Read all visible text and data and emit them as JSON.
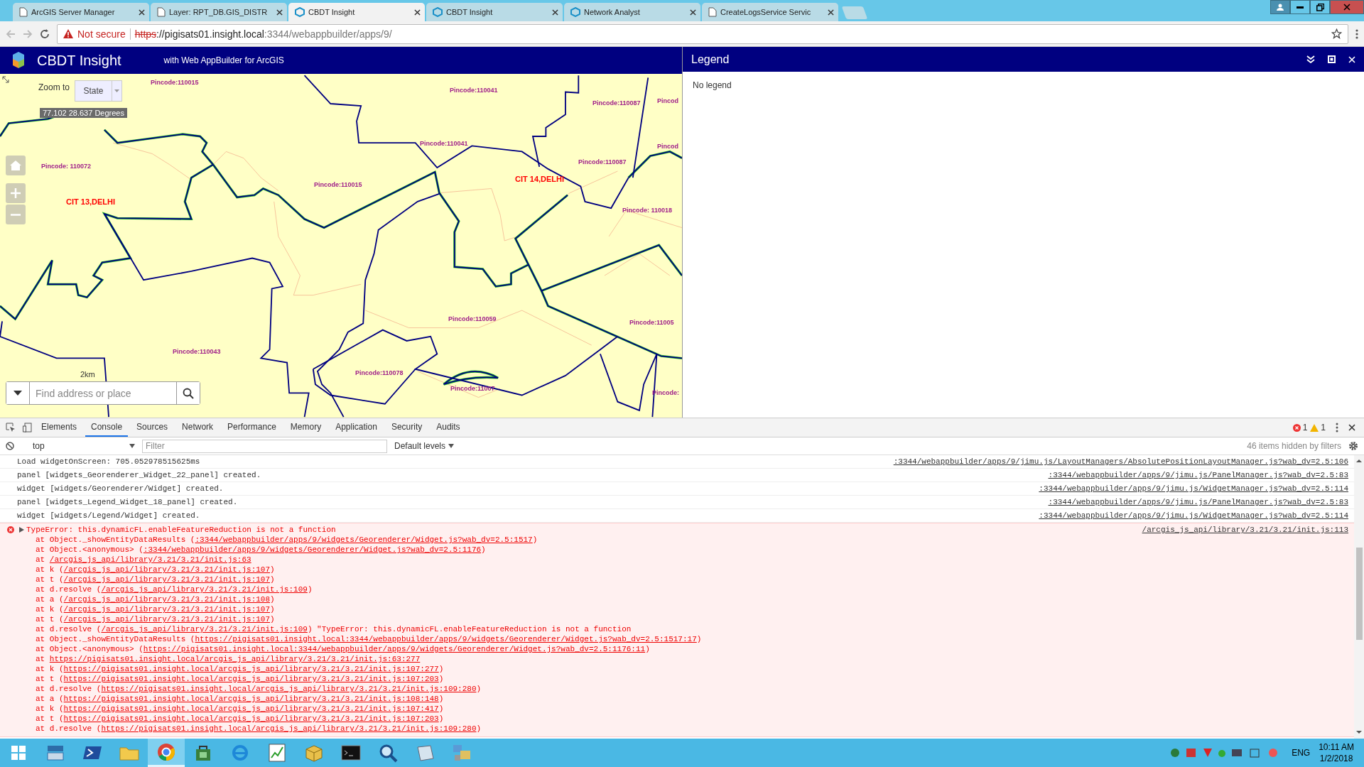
{
  "browser": {
    "tabs": [
      {
        "title": "ArcGIS Server Manager",
        "kind": "page",
        "selected": false
      },
      {
        "title": "Layer: RPT_DB.GIS_DISTR",
        "kind": "page",
        "selected": false
      },
      {
        "title": "CBDT Insight",
        "kind": "app",
        "selected": true
      },
      {
        "title": "CBDT Insight",
        "kind": "app",
        "selected": false
      },
      {
        "title": "Network Analyst",
        "kind": "app",
        "selected": false
      },
      {
        "title": "CreateLogsService Servic",
        "kind": "page",
        "selected": false
      }
    ],
    "security": "Not secure",
    "scheme": "https",
    "host": "://pigisats01.insight.local",
    "path": ":3344/webappbuilder/apps/9/"
  },
  "app": {
    "title": "CBDT Insight",
    "subtitle": "with Web AppBuilder for ArcGIS"
  },
  "map": {
    "zoom_to_label": "Zoom to",
    "zoom_to_value": "State",
    "coordinates": "77.102 28.637 Degrees",
    "scale_label": "2km",
    "search_placeholder": "Find address or place",
    "labels": [
      {
        "text": "Pincode:110015",
        "kind": "pincode"
      },
      {
        "text": "Pincode:110041",
        "kind": "pincode"
      },
      {
        "text": "Pincode:110087",
        "kind": "pincode"
      },
      {
        "text": "Pincod",
        "kind": "pincode"
      },
      {
        "text": "Pincode: 110072",
        "kind": "pincode"
      },
      {
        "text": "Pincode:110041",
        "kind": "pincode"
      },
      {
        "text": "Pincode:110087",
        "kind": "pincode"
      },
      {
        "text": "Pincod",
        "kind": "pincode"
      },
      {
        "text": "Pincode:110015",
        "kind": "pincode"
      },
      {
        "text": "CIT 14,DELHI",
        "kind": "city"
      },
      {
        "text": "CIT 13,DELHI",
        "kind": "city"
      },
      {
        "text": "Pincode: 110018",
        "kind": "pincode"
      },
      {
        "text": "Pincode:110059",
        "kind": "pincode"
      },
      {
        "text": "Pincode:11005",
        "kind": "pincode"
      },
      {
        "text": "Pincode:110043",
        "kind": "pincode"
      },
      {
        "text": "Pincode:110078",
        "kind": "pincode"
      },
      {
        "text": "Pincode:11007",
        "kind": "pincode"
      },
      {
        "text": "Pincode:",
        "kind": "pincode"
      }
    ]
  },
  "legend": {
    "title": "Legend",
    "message": "No legend"
  },
  "devtools": {
    "tabs": [
      {
        "label": "Elements",
        "selected": false
      },
      {
        "label": "Console",
        "selected": true
      },
      {
        "label": "Sources",
        "selected": false
      },
      {
        "label": "Network",
        "selected": false
      },
      {
        "label": "Performance",
        "selected": false
      },
      {
        "label": "Memory",
        "selected": false
      },
      {
        "label": "Application",
        "selected": false
      },
      {
        "label": "Security",
        "selected": false
      },
      {
        "label": "Audits",
        "selected": false
      }
    ],
    "error_count": "1",
    "warning_count": "1",
    "context": "top",
    "filter_placeholder": "Filter",
    "levels": "Default levels",
    "hidden_note": "46 items hidden by filters",
    "logs": [
      {
        "text": "Load widgetOnScreen: 705.052978515625ms",
        "source": ":3344/webappbuilder/apps/9/jimu.js/LayoutManagers/AbsolutePositionLayoutManager.js?wab_dv=2.5:106"
      },
      {
        "text": "panel [widgets_Georenderer_Widget_22_panel] created.",
        "source": ":3344/webappbuilder/apps/9/jimu.js/PanelManager.js?wab_dv=2.5:83"
      },
      {
        "text": "widget [widgets/Georenderer/Widget] created.",
        "source": ":3344/webappbuilder/apps/9/jimu.js/WidgetManager.js?wab_dv=2.5:114"
      },
      {
        "text": "panel [widgets_Legend_Widget_18_panel] created.",
        "source": ":3344/webappbuilder/apps/9/jimu.js/PanelManager.js?wab_dv=2.5:83"
      },
      {
        "text": "widget [widgets/Legend/Widget] created.",
        "source": ":3344/webappbuilder/apps/9/jimu.js/WidgetManager.js?wab_dv=2.5:114"
      }
    ],
    "error": {
      "message": "TypeError: this.dynamicFL.enableFeatureReduction is not a function",
      "source": "/arcgis_js_api/library/3.21/3.21/init.js:113",
      "stack": [
        {
          "prefix": "at Object._showEntityDataResults (",
          "link": ":3344/webappbuilder/apps/9/widgets/Georenderer/Widget.js?wab_dv=2.5:1517",
          "suffix": ")"
        },
        {
          "prefix": "at Object.<anonymous> (",
          "link": ":3344/webappbuilder/apps/9/widgets/Georenderer/Widget.js?wab_dv=2.5:1176",
          "suffix": ")"
        },
        {
          "prefix": "at ",
          "link": "/arcgis_js_api/library/3.21/3.21/init.js:63"
        },
        {
          "prefix": "at k (",
          "link": "/arcgis_js_api/library/3.21/3.21/init.js:107",
          "suffix": ")"
        },
        {
          "prefix": "at t (",
          "link": "/arcgis_js_api/library/3.21/3.21/init.js:107",
          "suffix": ")"
        },
        {
          "prefix": "at d.resolve (",
          "link": "/arcgis_js_api/library/3.21/3.21/init.js:109",
          "suffix": ")"
        },
        {
          "prefix": "at a (",
          "link": "/arcgis_js_api/library/3.21/3.21/init.js:108",
          "suffix": ")"
        },
        {
          "prefix": "at k (",
          "link": "/arcgis_js_api/library/3.21/3.21/init.js:107",
          "suffix": ")"
        },
        {
          "prefix": "at t (",
          "link": "/arcgis_js_api/library/3.21/3.21/init.js:107",
          "suffix": ")"
        },
        {
          "prefix": "at d.resolve (",
          "link": "/arcgis_js_api/library/3.21/3.21/init.js:109",
          "suffix": ") \"TypeError: this.dynamicFL.enableFeatureReduction is not a function"
        },
        {
          "prefix": "at Object._showEntityDataResults (",
          "link": "https://pigisats01.insight.local:3344/webappbuilder/apps/9/widgets/Georenderer/Widget.js?wab_dv=2.5:1517:17",
          "suffix": ")"
        },
        {
          "prefix": "at Object.<anonymous> (",
          "link": "https://pigisats01.insight.local:3344/webappbuilder/apps/9/widgets/Georenderer/Widget.js?wab_dv=2.5:1176:11",
          "suffix": ")"
        },
        {
          "prefix": "at ",
          "link": "https://pigisats01.insight.local/arcgis_js_api/library/3.21/3.21/init.js:63:277"
        },
        {
          "prefix": "at k (",
          "link": "https://pigisats01.insight.local/arcgis_js_api/library/3.21/3.21/init.js:107:277",
          "suffix": ")"
        },
        {
          "prefix": "at t (",
          "link": "https://pigisats01.insight.local/arcgis_js_api/library/3.21/3.21/init.js:107:203",
          "suffix": ")"
        },
        {
          "prefix": "at d.resolve (",
          "link": "https://pigisats01.insight.local/arcgis_js_api/library/3.21/3.21/init.js:109:280",
          "suffix": ")"
        },
        {
          "prefix": "at a (",
          "link": "https://pigisats01.insight.local/arcgis_js_api/library/3.21/3.21/init.js:108:148",
          "suffix": ")"
        },
        {
          "prefix": "at k (",
          "link": "https://pigisats01.insight.local/arcgis_js_api/library/3.21/3.21/init.js:107:417",
          "suffix": ")"
        },
        {
          "prefix": "at t (",
          "link": "https://pigisats01.insight.local/arcgis_js_api/library/3.21/3.21/init.js:107:203",
          "suffix": ")"
        },
        {
          "prefix": "at d.resolve (",
          "link": "https://pigisats01.insight.local/arcgis_js_api/library/3.21/3.21/init.js:109:280",
          "suffix": ")"
        }
      ]
    }
  },
  "taskbar": {
    "apps": [
      {
        "kind": "server",
        "selected": false
      },
      {
        "kind": "powershell",
        "selected": false
      },
      {
        "kind": "folder",
        "selected": false
      },
      {
        "kind": "chrome",
        "selected": true
      },
      {
        "kind": "store",
        "selected": false
      },
      {
        "kind": "globe",
        "selected": false
      },
      {
        "kind": "chart",
        "selected": false
      },
      {
        "kind": "package",
        "selected": false
      },
      {
        "kind": "cmd",
        "selected": false
      },
      {
        "kind": "magnifier",
        "selected": false
      },
      {
        "kind": "notepad",
        "selected": false
      },
      {
        "kind": "network",
        "selected": false
      }
    ],
    "language": "ENG",
    "time": "10:11 AM",
    "date": "1/2/2018"
  }
}
